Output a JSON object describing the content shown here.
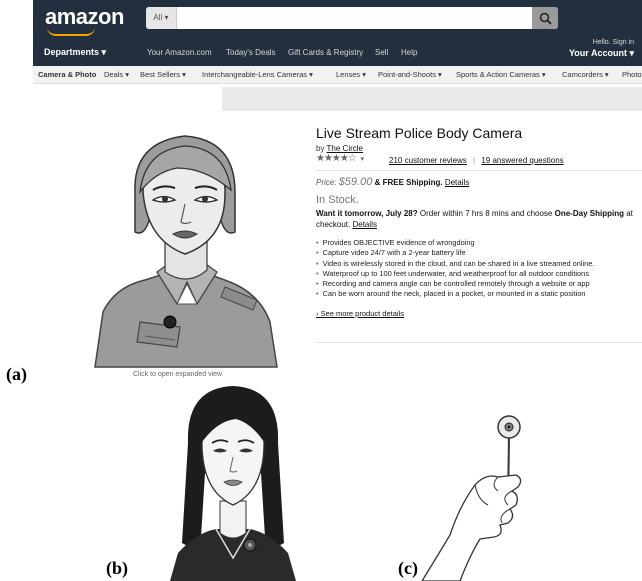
{
  "header": {
    "logo": "amazon",
    "search_category": "All ▾",
    "search_placeholder": "",
    "departments": "Departments ▾",
    "nav_links": [
      "Your Amazon.com",
      "Today's Deals",
      "Gift Cards & Registry",
      "Sell",
      "Help"
    ],
    "account_greeting": "Hello. Sign in",
    "account_label": "Your Account ▾"
  },
  "subnav": [
    "Camera & Photo",
    "Deals ▾",
    "Best Sellers ▾",
    "Interchangeable-Lens Cameras ▾",
    "Lenses ▾",
    "Point-and-Shoots ▾",
    "Sports & Action Cameras ▾",
    "Camcorders ▾",
    "Photog"
  ],
  "product": {
    "image_caption": "Click to open expanded view",
    "title": "Live Stream Police Body Camera",
    "by_prefix": "by",
    "brand": "The Circle",
    "stars": "★★★★☆",
    "stars_caret": "▾",
    "reviews": "210 customer reviews",
    "review_sep": "|",
    "questions": "19 answered questions",
    "price_label": "Price:",
    "price": "$59.00",
    "shipping": "& FREE Shipping.",
    "shipping_details": "Details",
    "stock": "In Stock.",
    "delivery_lead": "Want it tomorrow, July 28?",
    "delivery_mid": "Order within 7 hrs 8 mins and choose",
    "delivery_option": "One-Day Shipping",
    "delivery_tail": "at checkout.",
    "delivery_details": "Details",
    "bullets": [
      "Provides OBJECTIVE evidence of wrongdoing",
      "Capture video 24/7 with a 2-year battery life",
      "Video is wirelessly stored in the cloud, and can be shared in a live streamed online.",
      "Waterproof up to 100 feet underwater, and weatherproof for all outdoor conditions",
      "Recording and camera angle can be controlled remotely through a website or app",
      "Can be worn around the neck, placed in a pocket, or mounted in a static position"
    ],
    "more_details": "› See more product details"
  },
  "figure_labels": {
    "a": "(a)",
    "b": "(b)",
    "c": "(c)"
  },
  "colors": {
    "header_bg": "#232f3e",
    "accent": "#f0a500"
  }
}
